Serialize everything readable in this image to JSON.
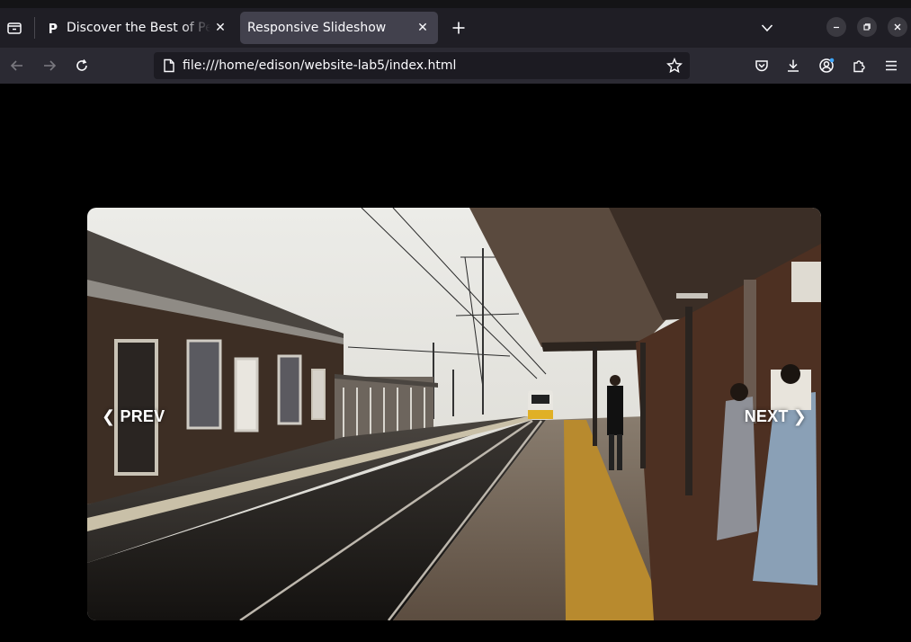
{
  "browser": {
    "tabs": [
      {
        "title": "Discover the Best of Pexels",
        "active": false
      },
      {
        "title": "Responsive Slideshow",
        "active": true
      }
    ],
    "url": "file:///home/edison/website-lab5/index.html"
  },
  "slideshow": {
    "prev_label": "❮ PREV",
    "next_label": "NEXT ❯"
  },
  "colors": {
    "tabbar_bg": "#1f1e25",
    "navbar_bg": "#2b2a33",
    "urlbar_bg": "#1c1b22",
    "active_tab_bg": "#42414d",
    "page_bg": "#000000"
  },
  "icons": {
    "tab_list": "tab-list-icon",
    "new_tab": "plus-icon",
    "back": "arrow-left-icon",
    "forward": "arrow-right-icon",
    "reload": "reload-icon",
    "bookmark": "star-icon",
    "pocket": "pocket-icon",
    "downloads": "download-icon",
    "account": "account-icon",
    "extensions": "puzzle-icon",
    "menu": "hamburger-menu-icon"
  }
}
